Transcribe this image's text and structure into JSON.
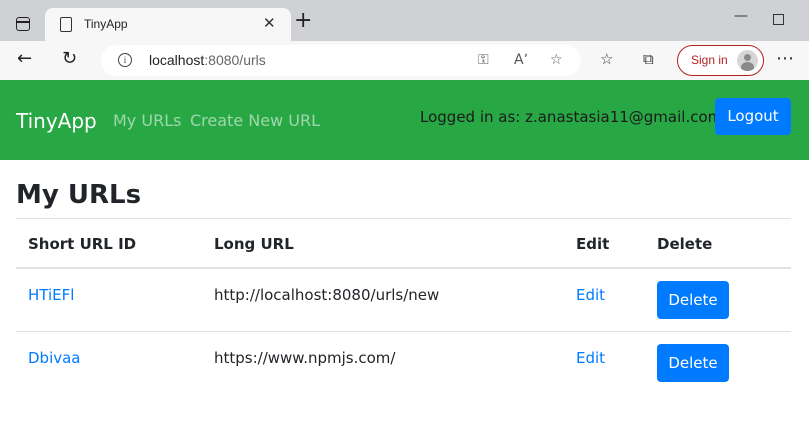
{
  "browser": {
    "tab_title": "TinyApp",
    "tab_close": "✕",
    "new_tab": "+",
    "url_host": "localhost",
    "url_path": ":8080/urls",
    "sign_in": "Sign in",
    "icons": [
      "tab-actions-icon",
      "page-icon",
      "back-icon",
      "refresh-icon",
      "info-icon",
      "key-icon",
      "read-aloud-icon",
      "add-favorite-icon",
      "favorites-icon",
      "collections-icon",
      "more-icon"
    ]
  },
  "navbar": {
    "brand": "TinyApp",
    "links": [
      "My URLs",
      "Create New URL"
    ],
    "logged_in": "Logged in as: z.anastasia11@gmail.com",
    "logout": "Logout",
    "color": "#28a745"
  },
  "main": {
    "title": "My URLs",
    "headers": [
      "Short URL ID",
      "Long URL",
      "Edit",
      "Delete"
    ],
    "rows": [
      {
        "id": "HTiEFl",
        "long": "http://localhost:8080/urls/new",
        "edit": "Edit",
        "delete": "Delete"
      },
      {
        "id": "Dbivaa",
        "long": "https://www.npmjs.com/",
        "edit": "Edit",
        "delete": "Delete"
      }
    ],
    "accent": "#007bff"
  }
}
